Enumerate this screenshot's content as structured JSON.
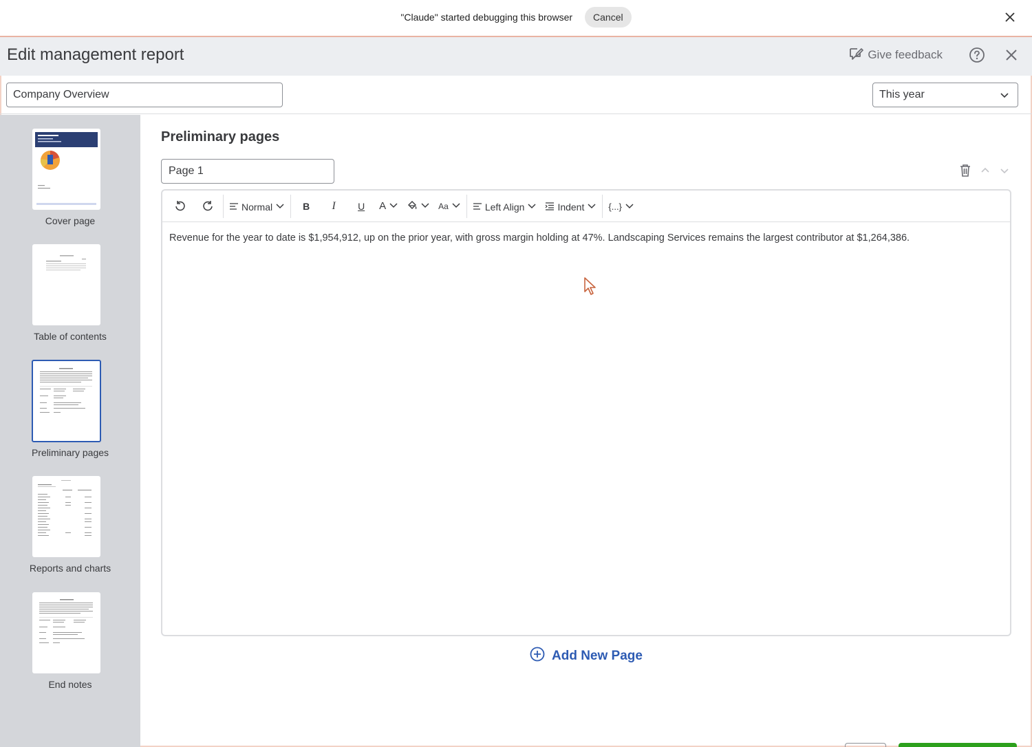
{
  "debug_bar": {
    "message": "\"Claude\" started debugging this browser",
    "cancel_label": "Cancel"
  },
  "modal": {
    "title": "Edit management report",
    "feedback_label": "Give feedback"
  },
  "top_row": {
    "report_name": "Company Overview",
    "period": "This year"
  },
  "sidebar": {
    "items": [
      {
        "label": "Cover page"
      },
      {
        "label": "Table of contents"
      },
      {
        "label": "Preliminary pages"
      },
      {
        "label": "Reports and charts"
      },
      {
        "label": "End notes"
      }
    ],
    "selected": "Preliminary pages"
  },
  "main": {
    "section_title": "Preliminary pages",
    "page_name": "Page 1",
    "toolbar": {
      "style": "Normal",
      "bold": "B",
      "italic": "I",
      "underline": "U",
      "font_color": "A",
      "font_size": "Aa",
      "align": "Left Align",
      "indent": "Indent",
      "variables": "{...}"
    },
    "body_text": "Revenue for the year to date is $1,954,912, up on the prior year, with gross margin holding at 47%. Landscaping Services remains the largest contributor at $1,264,386.",
    "add_page_label": "Add New Page"
  },
  "colors": {
    "accent": "#2d5bb3",
    "sidebar_bg": "#d4d6da",
    "header_bg": "#eceef1",
    "cover_banner": "#2b3f73"
  }
}
